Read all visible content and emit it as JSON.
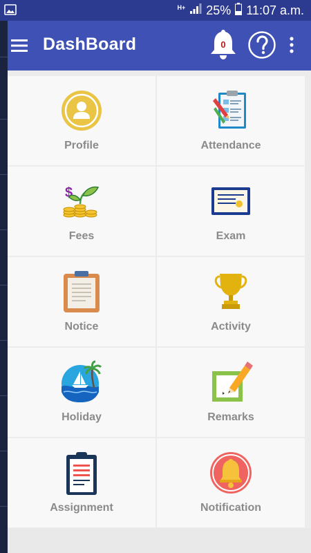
{
  "status_bar": {
    "network_type": "H+",
    "battery": "25%",
    "time": "11:07 a.m."
  },
  "toolbar": {
    "title": "DashBoard",
    "notification_count": "0",
    "icons": [
      "menu-icon",
      "bell-icon",
      "help-icon",
      "more-vert-icon"
    ]
  },
  "colors": {
    "status_bar": "#2c3a8f",
    "toolbar": "#3f51b5",
    "tile_background": "#f8f8f8",
    "label_text": "#8a8a8a"
  },
  "tiles": [
    {
      "label": "Profile",
      "icon": "profile-icon"
    },
    {
      "label": "Attendance",
      "icon": "attendance-icon"
    },
    {
      "label": "Fees",
      "icon": "fees-icon"
    },
    {
      "label": "Exam",
      "icon": "exam-icon"
    },
    {
      "label": "Notice",
      "icon": "notice-icon"
    },
    {
      "label": "Activity",
      "icon": "activity-icon"
    },
    {
      "label": "Holiday",
      "icon": "holiday-icon"
    },
    {
      "label": "Remarks",
      "icon": "remarks-icon"
    },
    {
      "label": "Assignment",
      "icon": "assignment-icon"
    },
    {
      "label": "Notification",
      "icon": "notification-icon"
    }
  ]
}
